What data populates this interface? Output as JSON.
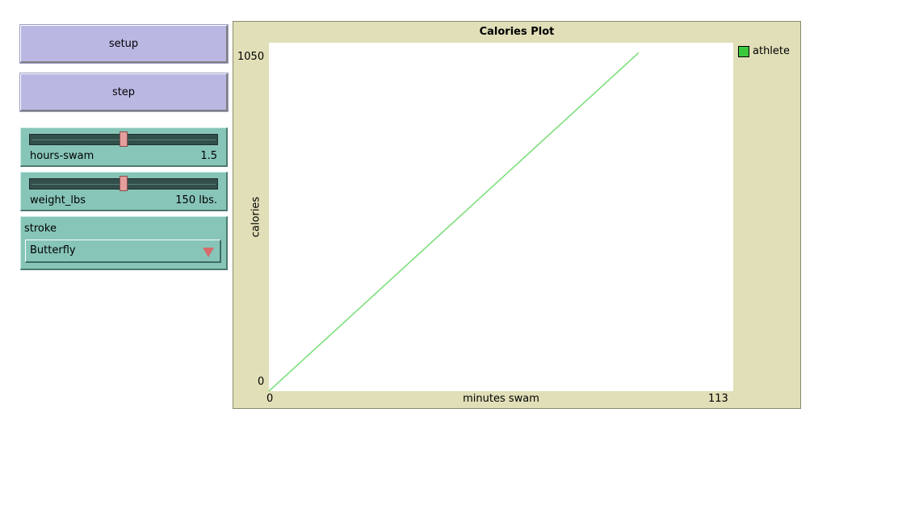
{
  "controls": {
    "setup_label": "setup",
    "step_label": "step"
  },
  "sliders": {
    "hours_swam": {
      "label": "hours-swam",
      "display": "1.5",
      "min": 0,
      "max": 3,
      "value": 1.5
    },
    "weight_lbs": {
      "label": "weight_lbs",
      "display": "150 lbs.",
      "min": 0,
      "max": 300,
      "value": 150
    }
  },
  "chooser": {
    "label": "stroke",
    "selected": "Butterfly",
    "arrow_color": "#d66b6b"
  },
  "colors": {
    "button_bg": "#bab8e3",
    "widget_bg": "#87c5b8",
    "plot_bg": "#e0dfb8"
  },
  "plot": {
    "title": "Calories Plot",
    "xlabel": "minutes swam",
    "ylabel": "calories",
    "xmin_label": "0",
    "xmax_label": "113",
    "ymin_label": "0",
    "ymax_label": "1050"
  },
  "chart_data": {
    "type": "line",
    "title": "Calories Plot",
    "xlabel": "minutes swam",
    "ylabel": "calories",
    "xlim": [
      0,
      113
    ],
    "ylim": [
      0,
      1050
    ],
    "grid": false,
    "legend": "top-right",
    "series": [
      {
        "name": "athlete",
        "color": "#3cc83c",
        "x": [
          0,
          90
        ],
        "y": [
          0,
          1020
        ]
      }
    ]
  }
}
